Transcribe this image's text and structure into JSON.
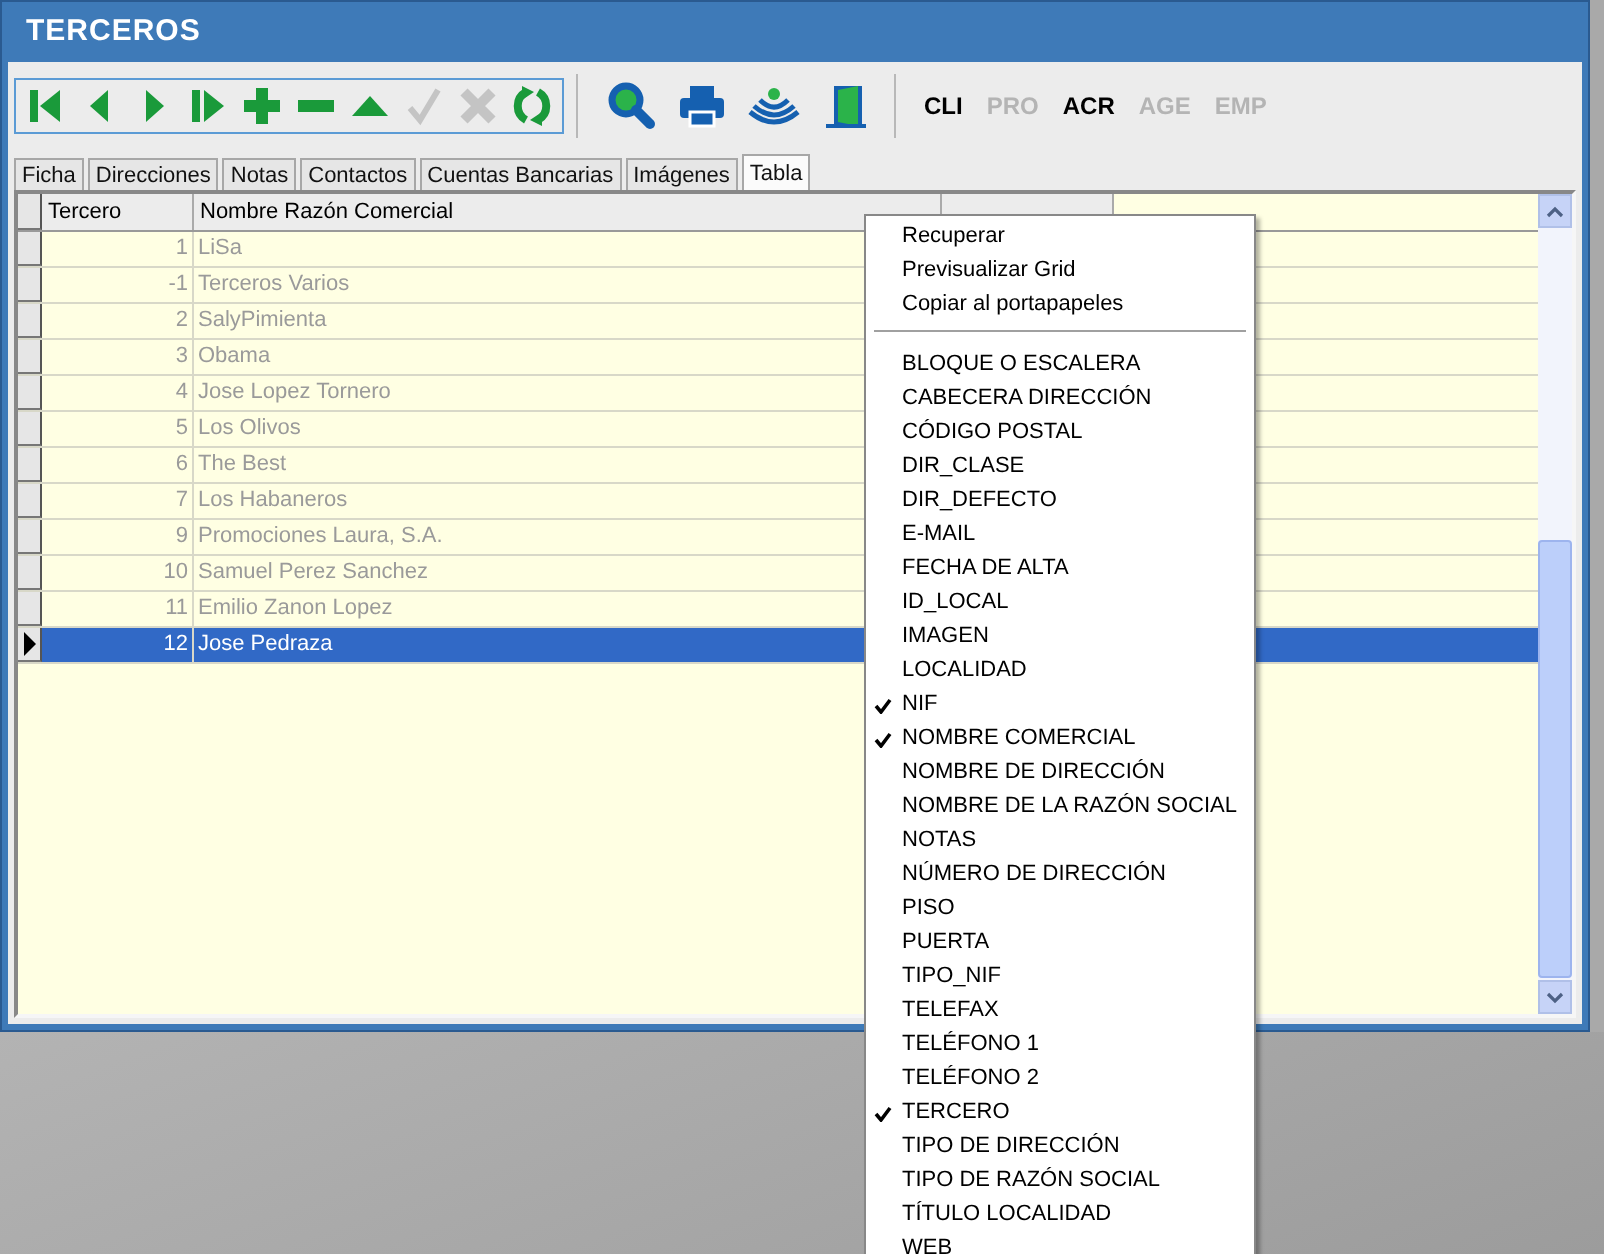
{
  "window": {
    "title": "TERCEROS"
  },
  "toolbar": {
    "nav_buttons": [
      {
        "kind": "first",
        "disabled": false
      },
      {
        "kind": "prev",
        "disabled": false
      },
      {
        "kind": "next",
        "disabled": false
      },
      {
        "kind": "last",
        "disabled": false
      },
      {
        "kind": "add",
        "disabled": false
      },
      {
        "kind": "remove",
        "disabled": false
      },
      {
        "kind": "up",
        "disabled": false
      },
      {
        "kind": "accept",
        "disabled": true
      },
      {
        "kind": "cancel",
        "disabled": true
      },
      {
        "kind": "refresh",
        "disabled": false
      }
    ],
    "tools": [
      {
        "kind": "search"
      },
      {
        "kind": "print"
      },
      {
        "kind": "signal"
      },
      {
        "kind": "exit"
      }
    ],
    "modules": [
      {
        "label": "CLI",
        "disabled": false
      },
      {
        "label": "PRO",
        "disabled": true
      },
      {
        "label": "ACR",
        "disabled": false
      },
      {
        "label": "AGE",
        "disabled": true
      },
      {
        "label": "EMP",
        "disabled": true
      }
    ]
  },
  "tabs": [
    {
      "label": "Ficha",
      "selected": false
    },
    {
      "label": "Direcciones",
      "selected": false
    },
    {
      "label": "Notas",
      "selected": false
    },
    {
      "label": "Contactos",
      "selected": false
    },
    {
      "label": "Cuentas Bancarias",
      "selected": false
    },
    {
      "label": "Imágenes",
      "selected": false
    },
    {
      "label": "Tabla",
      "selected": true
    }
  ],
  "grid": {
    "columns": [
      "Tercero",
      "Nombre Razón Comercial"
    ],
    "rows": [
      {
        "id": "1",
        "name": "LiSa",
        "selected": false
      },
      {
        "id": "-1",
        "name": "Terceros Varios",
        "selected": false
      },
      {
        "id": "2",
        "name": "SalyPimienta",
        "selected": false
      },
      {
        "id": "3",
        "name": "Obama",
        "selected": false
      },
      {
        "id": "4",
        "name": "Jose Lopez Tornero",
        "selected": false
      },
      {
        "id": "5",
        "name": "Los Olivos",
        "selected": false
      },
      {
        "id": "6",
        "name": "The Best",
        "selected": false
      },
      {
        "id": "7",
        "name": "Los Habaneros",
        "selected": false
      },
      {
        "id": "9",
        "name": "Promociones Laura, S.A.",
        "selected": false
      },
      {
        "id": "10",
        "name": "Samuel Perez Sanchez",
        "selected": false
      },
      {
        "id": "11",
        "name": "Emilio Zanon Lopez",
        "selected": false
      },
      {
        "id": "12",
        "name": "Jose Pedraza",
        "selected": true
      }
    ]
  },
  "context_menu": {
    "actions": [
      "Recuperar",
      "Previsualizar Grid",
      "Copiar al portapapeles"
    ],
    "columns": [
      {
        "label": "BLOQUE O ESCALERA",
        "checked": false
      },
      {
        "label": "CABECERA DIRECCIÓN",
        "checked": false
      },
      {
        "label": "CÓDIGO POSTAL",
        "checked": false
      },
      {
        "label": "DIR_CLASE",
        "checked": false
      },
      {
        "label": "DIR_DEFECTO",
        "checked": false
      },
      {
        "label": "E-MAIL",
        "checked": false
      },
      {
        "label": "FECHA DE ALTA",
        "checked": false
      },
      {
        "label": "ID_LOCAL",
        "checked": false
      },
      {
        "label": "IMAGEN",
        "checked": false
      },
      {
        "label": "LOCALIDAD",
        "checked": false
      },
      {
        "label": "NIF",
        "checked": true
      },
      {
        "label": "NOMBRE COMERCIAL",
        "checked": true
      },
      {
        "label": "NOMBRE DE DIRECCIÓN",
        "checked": false
      },
      {
        "label": "NOMBRE DE LA RAZÓN SOCIAL",
        "checked": false
      },
      {
        "label": "NOTAS",
        "checked": false
      },
      {
        "label": "NÚMERO DE DIRECCIÓN",
        "checked": false
      },
      {
        "label": "PISO",
        "checked": false
      },
      {
        "label": "PUERTA",
        "checked": false
      },
      {
        "label": "TIPO_NIF",
        "checked": false
      },
      {
        "label": "TELEFAX",
        "checked": false
      },
      {
        "label": "TELÉFONO 1",
        "checked": false
      },
      {
        "label": "TELÉFONO 2",
        "checked": false
      },
      {
        "label": "TERCERO",
        "checked": true
      },
      {
        "label": "TIPO DE DIRECCIÓN",
        "checked": false
      },
      {
        "label": "TIPO DE RAZÓN SOCIAL",
        "checked": false
      },
      {
        "label": "TÍTULO LOCALIDAD",
        "checked": false
      },
      {
        "label": "WEB",
        "checked": false
      }
    ]
  }
}
